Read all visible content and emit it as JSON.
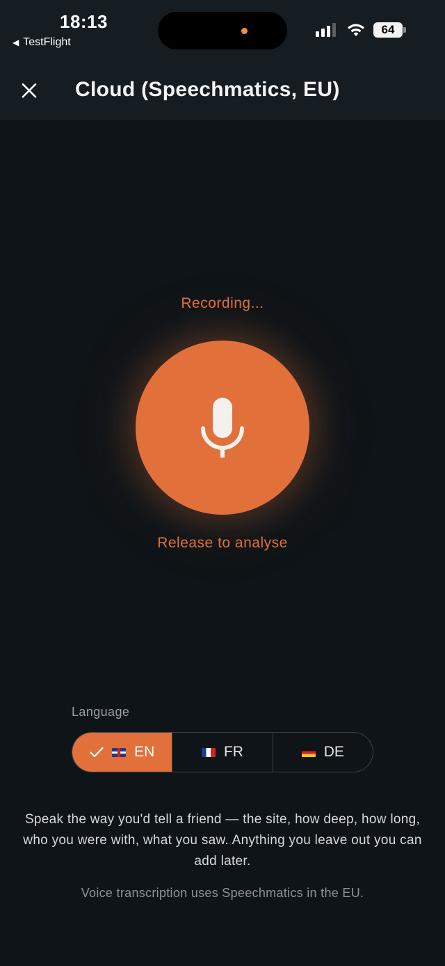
{
  "status_bar": {
    "time": "18:13",
    "back_app": "TestFlight",
    "battery": "64",
    "signal_bars_active": 3,
    "signal_bars_total": 4
  },
  "header": {
    "title": "Cloud (Speechmatics, EU)",
    "close_icon": "close-icon"
  },
  "recorder": {
    "status": "Recording...",
    "mic_icon": "microphone-icon",
    "hint": "Release to analyse",
    "accent": "#e2703a"
  },
  "language": {
    "label": "Language",
    "selected": "EN",
    "options": [
      {
        "code": "EN",
        "flag": "uk-flag-icon",
        "selected": true
      },
      {
        "code": "FR",
        "flag": "france-flag-icon",
        "selected": false
      },
      {
        "code": "DE",
        "flag": "germany-flag-icon",
        "selected": false
      }
    ]
  },
  "helper_text": "Speak the way you'd tell a friend — the site, how deep, how long, who you were with, what you saw. Anything you leave out you can add later.",
  "footnote": "Voice transcription uses Speechmatics in the EU."
}
